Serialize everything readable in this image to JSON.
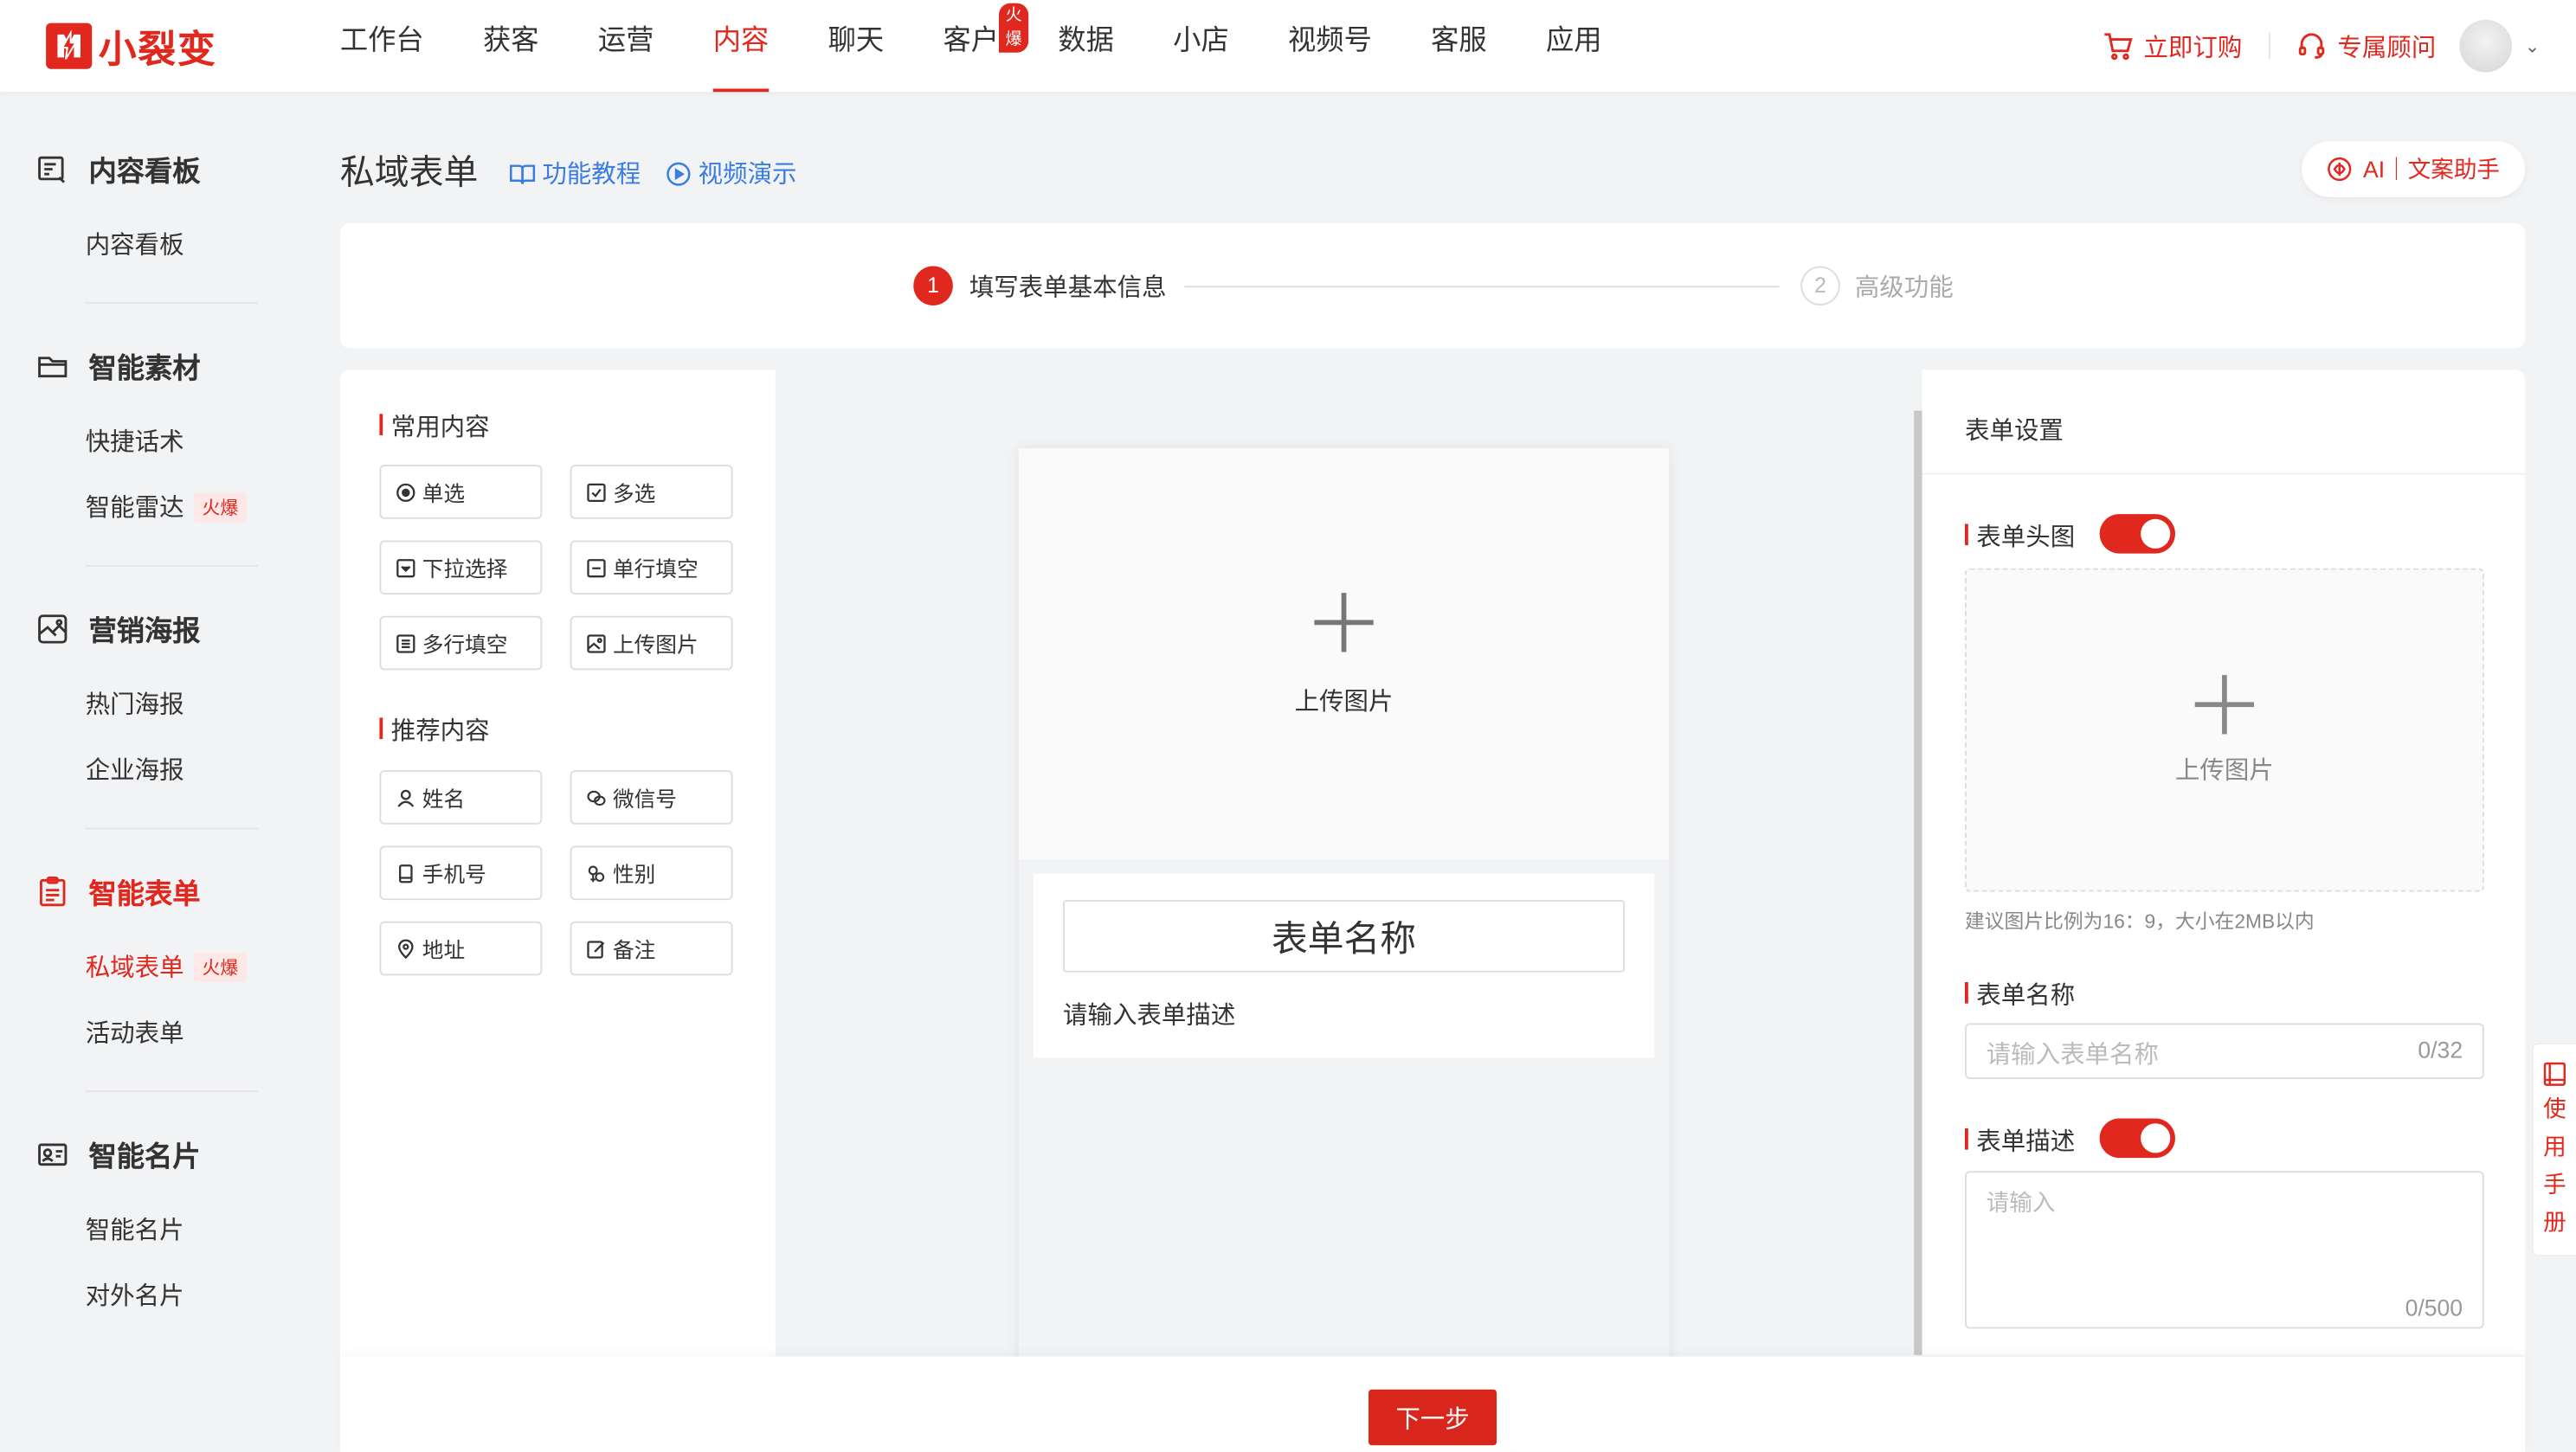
{
  "brand": {
    "name": "小裂变",
    "accent": "#e0281e"
  },
  "nav": {
    "items": [
      "工作台",
      "获客",
      "运营",
      "内容",
      "聊天",
      "客户",
      "数据",
      "小店",
      "视频号",
      "客服",
      "应用"
    ],
    "active": "内容",
    "hot_badge": "火爆"
  },
  "top_actions": {
    "subscribe": "立即订购",
    "consultant": "专属顾问"
  },
  "sidebar": {
    "groups": [
      {
        "title": "内容看板",
        "icon": "dashboard-icon",
        "items": [
          {
            "label": "内容看板"
          }
        ]
      },
      {
        "title": "智能素材",
        "icon": "folder-icon",
        "items": [
          {
            "label": "快捷话术"
          },
          {
            "label": "智能雷达",
            "badge": "火爆"
          }
        ]
      },
      {
        "title": "营销海报",
        "icon": "poster-icon",
        "items": [
          {
            "label": "热门海报"
          },
          {
            "label": "企业海报"
          }
        ]
      },
      {
        "title": "智能表单",
        "icon": "form-icon",
        "active": true,
        "items": [
          {
            "label": "私域表单",
            "badge": "火爆",
            "active": true
          },
          {
            "label": "活动表单"
          }
        ]
      },
      {
        "title": "智能名片",
        "icon": "card-icon",
        "items": [
          {
            "label": "智能名片"
          },
          {
            "label": "对外名片"
          }
        ]
      }
    ]
  },
  "header": {
    "title": "私域表单",
    "tutorial": "功能教程",
    "video": "视频演示",
    "ai": "AI｜文案助手"
  },
  "steps": [
    {
      "number": "1",
      "label": "填写表单基本信息",
      "active": true
    },
    {
      "number": "2",
      "label": "高级功能",
      "active": false
    }
  ],
  "components": {
    "common_title": "常用内容",
    "common": [
      {
        "label": "单选",
        "icon": "radio-icon"
      },
      {
        "label": "多选",
        "icon": "checkbox-icon"
      },
      {
        "label": "下拉选择",
        "icon": "dropdown-icon"
      },
      {
        "label": "单行填空",
        "icon": "single-line-icon"
      },
      {
        "label": "多行填空",
        "icon": "multi-line-icon"
      },
      {
        "label": "上传图片",
        "icon": "image-icon"
      }
    ],
    "recommended_title": "推荐内容",
    "recommended": [
      {
        "label": "姓名",
        "icon": "user-icon"
      },
      {
        "label": "微信号",
        "icon": "wechat-icon"
      },
      {
        "label": "手机号",
        "icon": "phone-icon"
      },
      {
        "label": "性别",
        "icon": "gender-icon"
      },
      {
        "label": "地址",
        "icon": "location-icon"
      },
      {
        "label": "备注",
        "icon": "note-icon"
      }
    ]
  },
  "preview": {
    "upload_label": "上传图片",
    "form_name": "表单名称",
    "form_desc": "请输入表单描述"
  },
  "settings": {
    "title": "表单设置",
    "header_image_label": "表单头图",
    "header_image_enabled": true,
    "upload_label": "上传图片",
    "hint": "建议图片比例为16：9，大小在2MB以内",
    "name_label": "表单名称",
    "name_placeholder": "请输入表单名称",
    "name_count": "0/32",
    "desc_label": "表单描述",
    "desc_enabled": true,
    "desc_placeholder": "请输入",
    "desc_count": "0/500"
  },
  "footer": {
    "next": "下一步"
  },
  "manual": {
    "chars": [
      "使",
      "用",
      "手",
      "册"
    ]
  }
}
